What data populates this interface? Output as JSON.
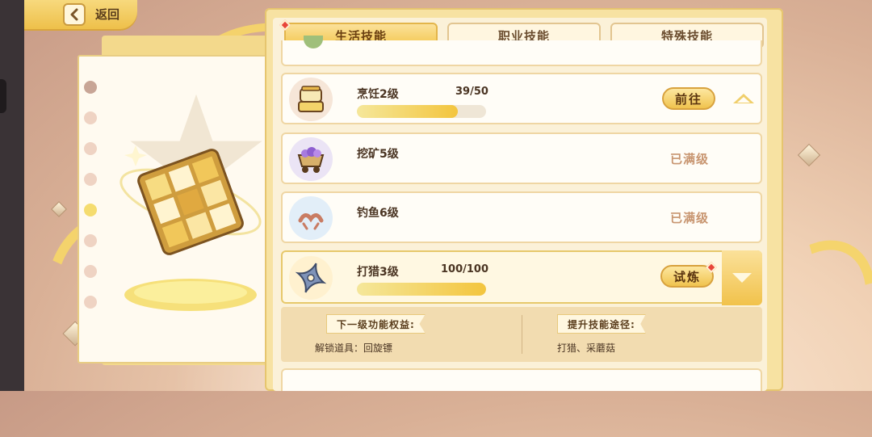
{
  "nav": {
    "back_label": "返回"
  },
  "tabs": [
    {
      "label": "生活技能",
      "active": true
    },
    {
      "label": "职业技能",
      "active": false
    },
    {
      "label": "特殊技能",
      "active": false
    }
  ],
  "skills": [
    {
      "name": "烹饪2级",
      "progress_text": "39/50",
      "progress": 0.78,
      "action": "前往",
      "icon": "cooking-pot-icon"
    },
    {
      "name": "挖矿5级",
      "status": "已满级",
      "icon": "mine-cart-icon"
    },
    {
      "name": "钓鱼6级",
      "status": "已满级",
      "icon": "fishing-lure-icon"
    },
    {
      "name": "打猎3级",
      "progress_text": "100/100",
      "progress": 1.0,
      "action": "试炼",
      "icon": "shuriken-icon"
    }
  ],
  "detail": {
    "benefit_title": "下一级功能权益:",
    "benefit_text": "解锁道具：回旋镖",
    "path_title": "提升技能途径:",
    "path_text": "打猎、采蘑菇"
  },
  "colors": {
    "accent": "#f3c64d",
    "alert": "#e8453a",
    "maxed_text": "#c89570"
  }
}
